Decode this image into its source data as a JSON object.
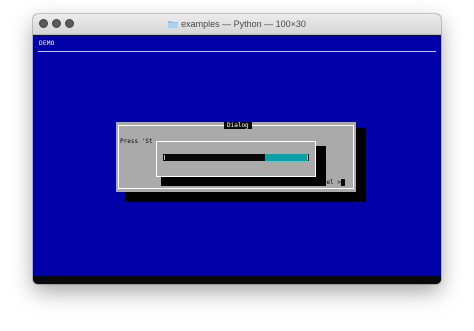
{
  "window": {
    "title": "examples — Python — 100×30",
    "folder_icon": "folder-icon"
  },
  "terminal": {
    "backtitle": "DEMO",
    "colors": {
      "background": "#0000aa",
      "dialog": "#aaaaaa",
      "shadow": "#000000",
      "gauge_fill": "#0ea0a8"
    }
  },
  "dialog": {
    "title": "Dialog",
    "message": "Press 'St",
    "cancel_label": "ncel >"
  },
  "gauge": {
    "progress_fraction": 0.3
  }
}
